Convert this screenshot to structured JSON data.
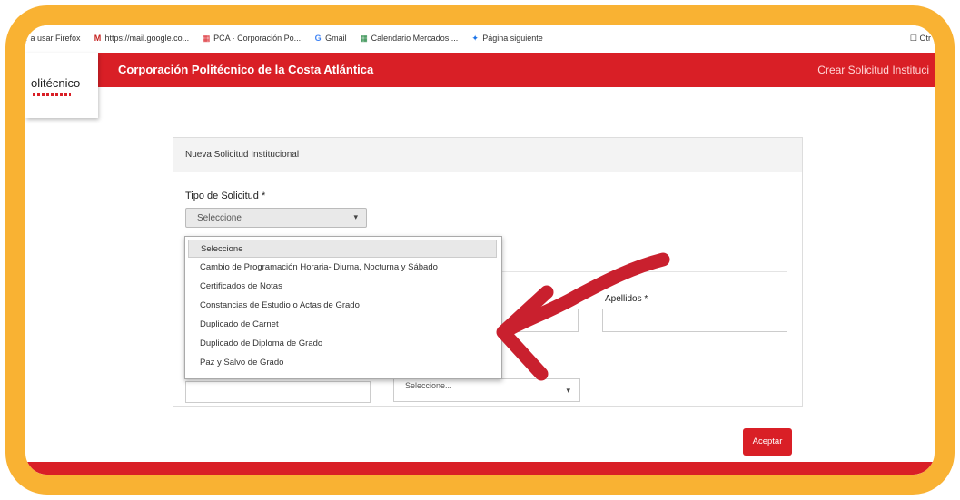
{
  "bookmarks": [
    {
      "icon": "",
      "label": "r a usar Firefox"
    },
    {
      "icon": "M",
      "label": "https://mail.google.co..."
    },
    {
      "icon": "▦",
      "label": "PCA · Corporación Po..."
    },
    {
      "icon": "G",
      "label": "Gmail"
    },
    {
      "icon": "▦",
      "label": "Calendario Mercados ..."
    },
    {
      "icon": "✦",
      "label": "Página siguiente"
    }
  ],
  "bookmarks_right": "☐ Otr",
  "header": {
    "logo_text": "olitécnico",
    "site_title": "Corporación Politécnico de la Costa Atlántica",
    "right_link": "Crear Solicitud Instituci"
  },
  "form": {
    "panel_title": "Nueva Solicitud Institucional",
    "tipo_label": "Tipo de Solicitud *",
    "tipo_selected": "Seleccione",
    "apellidos_label": "Apellidos *",
    "second_select_value": "Seleccione..."
  },
  "dropdown_options": [
    "Seleccione",
    "Cambio de Programación Horaria- Diurna, Nocturna y Sábado",
    "Certificados de Notas",
    "Constancias de Estudio o Actas de Grado",
    "Duplicado de Carnet",
    "Duplicado de Diploma de Grado",
    "Paz y Salvo de Grado"
  ],
  "accept_label": "Aceptar",
  "colors": {
    "frame": "#f9b233",
    "brand_red": "#d91f26",
    "arrow": "#c9202e"
  }
}
